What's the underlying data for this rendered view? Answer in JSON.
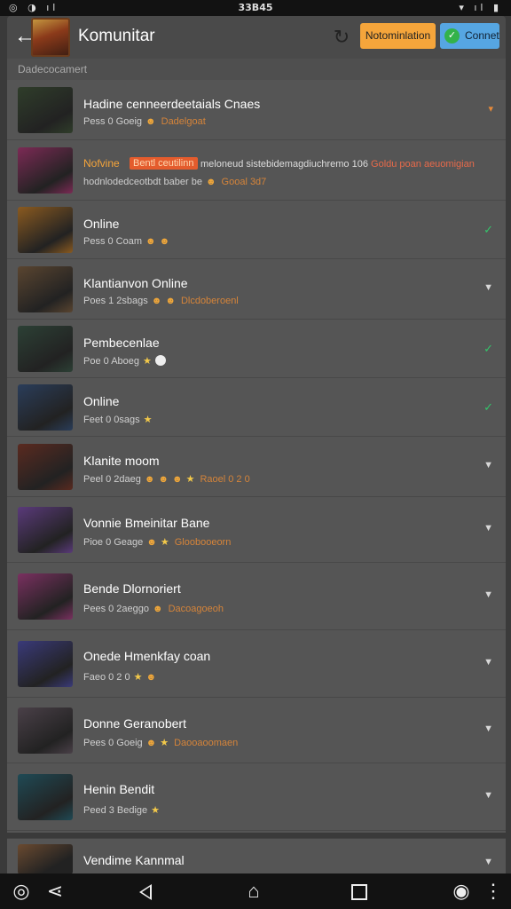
{
  "status_bar": {
    "left": "◎ ◑ ıl",
    "time": "33B45",
    "right": "▾ ıl ▮"
  },
  "app_bar": {
    "back_icon": "←",
    "title": "Komunitar",
    "sync_icon": "↻",
    "notif_label": "Notominlation",
    "connect_label": "Connet",
    "connect_check": "✓"
  },
  "section": {
    "title": "Dadecocamert"
  },
  "contacts": [
    {
      "name": "Hadine cenneerdeetaials Cnaes",
      "sub": "Pess 0 Goeig",
      "extra": "Dadelgoat",
      "icons": [
        "emoji"
      ],
      "indicator": "▾",
      "indicator_type": "orange",
      "avatar": "#2f3d2a"
    },
    {
      "name": "Nofvine",
      "badge": "Bentl ceutilinn",
      "alert_line": "meloneud sistebidemagdiuchremo 106",
      "alert_red": "Goldu poan aeuomigian",
      "sub": "hodnlodedceotbdt baber be",
      "extra": "Gooal 3d7",
      "icons": [
        "emoji"
      ],
      "indicator": "",
      "indicator_type": "none",
      "avatar": "#7c2a55"
    },
    {
      "name": "Online",
      "sub": "Pess 0 Coam",
      "extra": "",
      "icons": [
        "emoji",
        "emoji"
      ],
      "indicator": "✓",
      "indicator_type": "check",
      "avatar": "#8a5a20"
    },
    {
      "name": "Klantianvon Online",
      "sub": "Poes 1 2sbags",
      "extra": "Dlcdoberoenl",
      "icons": [
        "emoji",
        "emoji"
      ],
      "indicator": "▼",
      "indicator_type": "down",
      "avatar": "#5a4530"
    },
    {
      "name": "Pembecenlae",
      "sub": "Poe 0 Aboeg",
      "extra": "",
      "icons": [
        "star",
        "dot"
      ],
      "indicator": "✓",
      "indicator_type": "check",
      "avatar": "#2c4035"
    },
    {
      "name": "Online",
      "sub": "Feet 0 0sags",
      "extra": "",
      "icons": [
        "star"
      ],
      "indicator": "✓",
      "indicator_type": "check",
      "avatar": "#2a3d5a"
    },
    {
      "name": "Klanite moom",
      "sub": "Peel 0 2daeg",
      "extra": "Raoel 0 2 0",
      "icons": [
        "emoji",
        "emoji",
        "emoji",
        "star"
      ],
      "indicator": "▼",
      "indicator_type": "down",
      "avatar": "#5a2a20"
    },
    {
      "name": "Vonnie Bmeinitar Bane",
      "sub": "Pioe 0 Geage",
      "extra": "Gloobooeorn",
      "icons": [
        "emoji",
        "star"
      ],
      "indicator": "▼",
      "indicator_type": "down",
      "avatar": "#5a3a7a"
    },
    {
      "name": "Bende Dlornoriert",
      "sub": "Pees 0 2aeggo",
      "extra": "Dacoagoeoh",
      "icons": [
        "emoji"
      ],
      "indicator": "▼",
      "indicator_type": "down",
      "avatar": "#7a3060"
    },
    {
      "name": "Onede Hmenkfay coan",
      "sub": "Faeo 0 2 0",
      "extra": "",
      "icons": [
        "star",
        "emoji"
      ],
      "indicator": "▼",
      "indicator_type": "down",
      "avatar": "#3a3a7a"
    },
    {
      "name": "Donne Geranobert",
      "sub": "Pees 0 Goeig",
      "extra": "Daooaoomaen",
      "icons": [
        "emoji",
        "star"
      ],
      "indicator": "▼",
      "indicator_type": "down",
      "avatar": "#4a4048"
    },
    {
      "name": "Henin Bendit",
      "sub": "Peed 3 Bedige",
      "extra": "",
      "icons": [
        "star"
      ],
      "indicator": "▼",
      "indicator_type": "down",
      "avatar": "#1f4a55"
    }
  ],
  "peek": {
    "name": "Vendime Kannmal",
    "indicator": "▼",
    "avatar": "#6a4a30"
  },
  "nav_bar": {
    "circle_icon": "◎",
    "share_icon": "⋖",
    "menu_dot_icon": "◉",
    "more_icon": "⋮"
  }
}
